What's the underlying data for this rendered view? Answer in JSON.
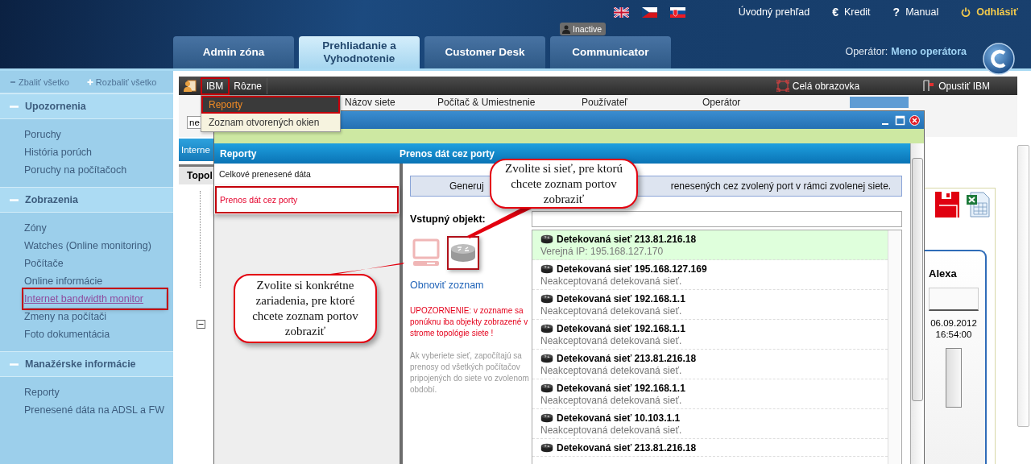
{
  "header": {
    "links": [
      {
        "kind": "text",
        "label": "Úvodný prehľad"
      },
      {
        "kind": "icon",
        "icon": "€",
        "label": "Kredit"
      },
      {
        "kind": "icon",
        "icon": "?",
        "label": "Manual"
      },
      {
        "kind": "logout",
        "label": "Odhlásiť"
      }
    ],
    "tabs": [
      {
        "label": "Admin zóna",
        "selected": false
      },
      {
        "label": "Prehliadanie a Vyhodnotenie",
        "selected": true
      },
      {
        "label": "Customer Desk",
        "selected": false
      },
      {
        "label": "Communicator",
        "selected": false,
        "badge": "Inactive"
      }
    ],
    "operator": {
      "label": "Operátor:",
      "name": "Meno operátora"
    }
  },
  "sidebar": {
    "collapse_all": "Zbaliť všetko",
    "expand_all": "Rozbaliť všetko",
    "sections": [
      {
        "title": "Upozornenia",
        "expanded": true,
        "items": [
          {
            "label": "Poruchy",
            "selected": false
          },
          {
            "label": "História porúch",
            "selected": false
          },
          {
            "label": "Poruchy na počítačoch",
            "selected": false
          }
        ]
      },
      {
        "title": "Zobrazenia",
        "expanded": true,
        "items": [
          {
            "label": "Zóny",
            "selected": false
          },
          {
            "label": "Watches (Online monitoring)",
            "selected": false
          },
          {
            "label": "Počítače",
            "selected": false
          },
          {
            "label": "Online informácie",
            "selected": false
          },
          {
            "label": "Internet bandwidth monitor",
            "selected": true
          },
          {
            "label": "Zmeny na počítači",
            "selected": false
          },
          {
            "label": "Foto dokumentácia",
            "selected": false
          }
        ]
      },
      {
        "title": "Manažérske informácie",
        "expanded": true,
        "items": [
          {
            "label": "Reporty",
            "selected": false
          },
          {
            "label": "Prenesené dáta na ADSL a FW",
            "selected": false
          }
        ]
      }
    ]
  },
  "main": {
    "menubar": {
      "items": [
        {
          "label": "IBM",
          "highlighted": true
        },
        {
          "label": "Rôzne",
          "highlighted": false
        }
      ],
      "actions": [
        {
          "kind": "fullscreen",
          "label": "Celá obrazovka"
        },
        {
          "kind": "exit",
          "label": "Opustiť IBM"
        }
      ]
    },
    "menu": {
      "items": [
        {
          "label": "Reporty",
          "highlighted": true
        },
        {
          "label": "Zoznam otvorených okien",
          "highlighted": false
        }
      ]
    },
    "columns": [
      "Názov siete",
      "Počítač & Umiestnenie",
      "Používateľ",
      "Operátor"
    ],
    "filter": {
      "value": "ne"
    },
    "side_tab": "Interne",
    "tree_heading": "Topol",
    "card": {
      "title": "Alexa",
      "date": "06.09.2012",
      "time": "16:54:00"
    }
  },
  "dialog": {
    "reports_heading": "Reporty",
    "reports": [
      {
        "label": "Celkové prenesené dáta",
        "selected": false
      },
      {
        "label": "Prenos dát cez porty",
        "selected": true
      }
    ],
    "title": "Prenos dát cez porty",
    "info": [
      "Generuj",
      "renesených cez zvolený port v rámci zvolenej siete."
    ],
    "input_label": "Vstupný objekt:",
    "object_types": [
      {
        "kind": "computer",
        "selected": false
      },
      {
        "kind": "network",
        "selected": true
      }
    ],
    "refresh": "Obnoviť zoznam",
    "warning": "UPOZORNENIE: v zozname sa ponúknu iba objekty zobrazené v strome topológie siete !",
    "note": "Ak vyberiete sieť, započítajú sa prenosy od všetkých počítačov pripojených do siete vo zvolenom období.",
    "networks": [
      {
        "name": "Detekovaná sieť 213.81.216.18",
        "status": "Verejná IP: 195.168.127.170",
        "selected": true
      },
      {
        "name": "Detekovaná sieť 195.168.127.169",
        "status": "Neakceptovaná detekovaná sieť.",
        "selected": false
      },
      {
        "name": "Detekovaná sieť 192.168.1.1",
        "status": "Neakceptovaná detekovaná sieť.",
        "selected": false
      },
      {
        "name": "Detekovaná sieť 192.168.1.1",
        "status": "Neakceptovaná detekovaná sieť.",
        "selected": false
      },
      {
        "name": "Detekovaná sieť 213.81.216.18",
        "status": "Neakceptovaná detekovaná sieť.",
        "selected": false
      },
      {
        "name": "Detekovaná sieť 192.168.1.1",
        "status": "Neakceptovaná detekovaná sieť.",
        "selected": false
      },
      {
        "name": "Detekovaná sieť 10.103.1.1",
        "status": "Neakceptovaná detekovaná sieť.",
        "selected": false
      },
      {
        "name": "Detekovaná sieť 213.81.216.18",
        "selected": false
      }
    ]
  },
  "callouts": [
    {
      "text": "Zvolite si sieť, pre ktorú chcete zoznam portov zobraziť"
    },
    {
      "text": "Zvolite si konkrétne zariadenia, pre ktoré chcete zoznam portov zobraziť"
    }
  ]
}
